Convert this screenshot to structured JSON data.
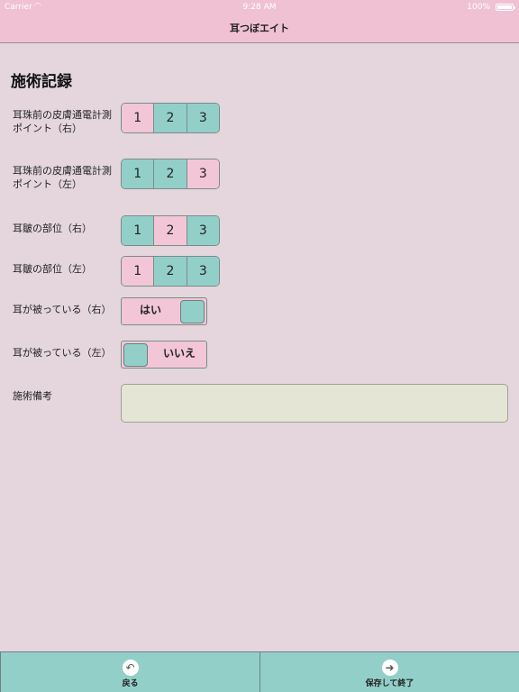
{
  "status_bar": {
    "carrier": "Carrier",
    "time": "9:28 AM",
    "battery": "100%"
  },
  "nav": {
    "title": "耳つぼエイト"
  },
  "section_title": "施術記録",
  "rows": [
    {
      "label": "耳珠前の皮膚通電計測ポイント（右）",
      "options": [
        "1",
        "2",
        "3"
      ],
      "selected": 0
    },
    {
      "label": "耳珠前の皮膚通電計測ポイント（左）",
      "options": [
        "1",
        "2",
        "3"
      ],
      "selected": 2
    },
    {
      "label": "耳皺の部位（右）",
      "options": [
        "1",
        "2",
        "3"
      ],
      "selected": 1
    },
    {
      "label": "耳皺の部位（左）",
      "options": [
        "1",
        "2",
        "3"
      ],
      "selected": 0
    }
  ],
  "toggles": [
    {
      "label": "耳が被っている（右）",
      "value": "はい",
      "on": true
    },
    {
      "label": "耳が被っている（左）",
      "value": "いいえ",
      "on": false
    }
  ],
  "notes": {
    "label": "施術備考",
    "value": ""
  },
  "tab_bar": {
    "back": "戻る",
    "save": "保存して終了"
  },
  "colors": {
    "pink": "#f2c6d6",
    "teal": "#93cfc9",
    "background": "#e4d6dc",
    "header": "#efc1d3"
  }
}
